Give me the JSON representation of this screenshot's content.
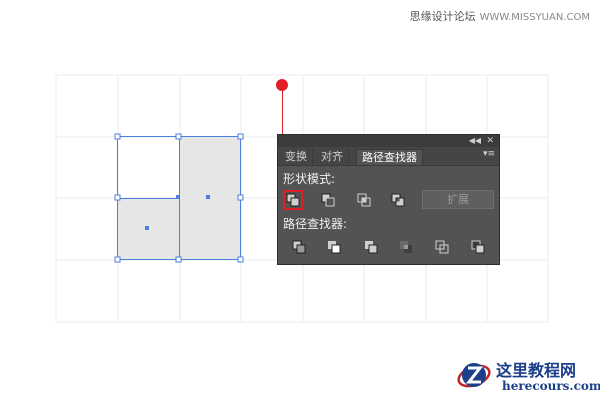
{
  "watermark": {
    "site_name": "思缘设计论坛",
    "site_url": "WWW.MISSYUAN.COM"
  },
  "panel": {
    "tabs": [
      {
        "label": "变换",
        "active": false
      },
      {
        "label": "对齐",
        "active": false
      },
      {
        "label": "路径查找器",
        "active": true
      }
    ],
    "shape_modes_label": "形状模式:",
    "shape_mode_buttons": [
      {
        "icon": "unite-icon",
        "highlighted": true
      },
      {
        "icon": "minus-front-icon",
        "highlighted": false
      },
      {
        "icon": "intersect-icon",
        "highlighted": false
      },
      {
        "icon": "exclude-icon",
        "highlighted": false
      }
    ],
    "expand_label": "扩展",
    "pathfinders_label": "路径查找器:",
    "pathfinder_buttons": [
      {
        "icon": "divide-icon"
      },
      {
        "icon": "trim-icon"
      },
      {
        "icon": "merge-icon"
      },
      {
        "icon": "crop-icon"
      },
      {
        "icon": "outline-icon"
      },
      {
        "icon": "minus-back-icon"
      }
    ]
  },
  "brand": {
    "name": "这里教程网",
    "url": "herecours.com"
  },
  "colors": {
    "selection": "#4a7fe0",
    "shape_fill": "#e6e6e6",
    "annotation": "#e01e25",
    "panel_bg": "#535353"
  }
}
